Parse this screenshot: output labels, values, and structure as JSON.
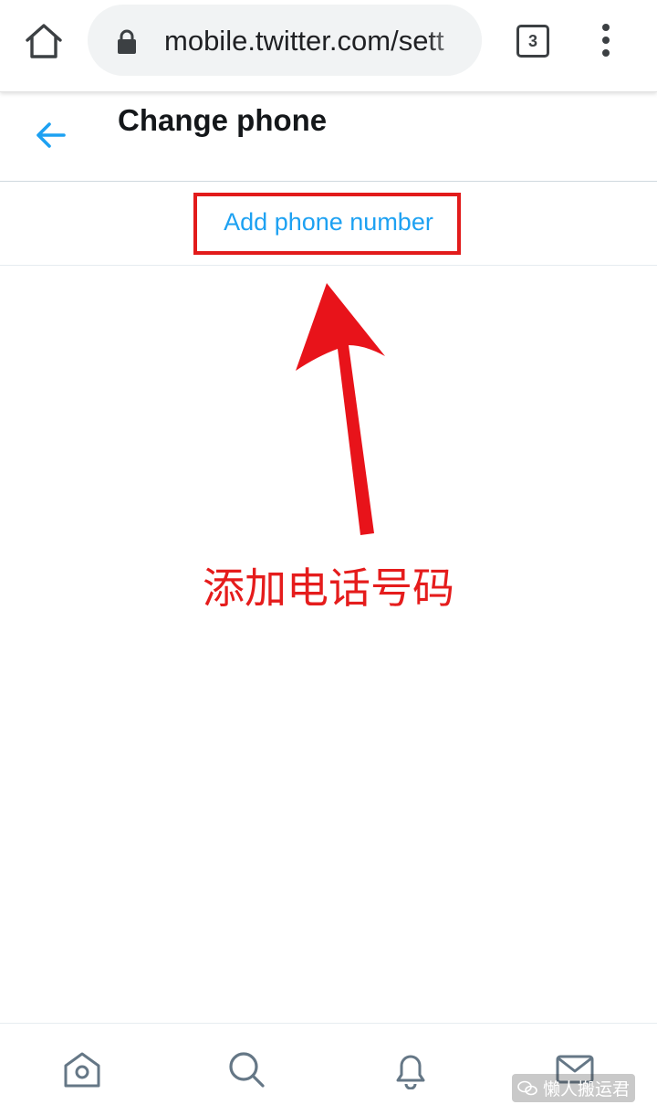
{
  "browser": {
    "url": "mobile.twitter.com/sett",
    "tab_count": "3",
    "icons": [
      "home-icon",
      "lock-icon",
      "tabs-icon",
      "more-vert-icon"
    ]
  },
  "header": {
    "title": "Change phone",
    "back_icon": "arrow-left-icon"
  },
  "main": {
    "add_phone_label": "Add phone number",
    "annotation": "添加电话号码"
  },
  "bottom_nav": {
    "items": [
      "home-icon",
      "search-icon",
      "notifications-icon",
      "messages-icon"
    ],
    "watermark": "懒人搬运君"
  },
  "colors": {
    "accent": "#1da1f2",
    "annotation_red": "#e21b1b",
    "icon_gray": "#657786"
  }
}
